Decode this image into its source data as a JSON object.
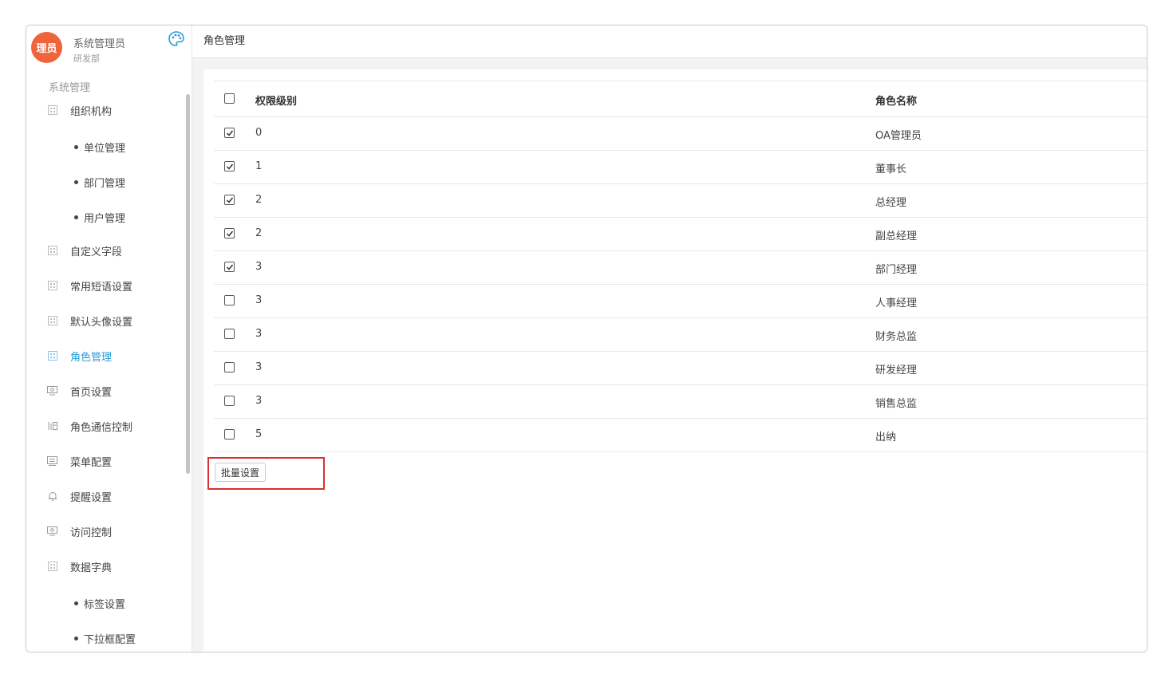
{
  "user": {
    "avatar_text": "理员",
    "name": "系统管理员",
    "department": "研发部"
  },
  "sidebar": {
    "section_title": "系统管理",
    "items": [
      {
        "label": "组织机构",
        "icon": "grid-icon"
      },
      {
        "label": "单位管理",
        "sub": true
      },
      {
        "label": "部门管理",
        "sub": true
      },
      {
        "label": "用户管理",
        "sub": true
      },
      {
        "label": "自定义字段",
        "icon": "grid-icon"
      },
      {
        "label": "常用短语设置",
        "icon": "grid-icon"
      },
      {
        "label": "默认头像设置",
        "icon": "grid-icon"
      },
      {
        "label": "角色管理",
        "icon": "grid-icon",
        "active": true
      },
      {
        "label": "首页设置",
        "icon": "monitor-icon"
      },
      {
        "label": "角色通信控制",
        "icon": "contacts-icon"
      },
      {
        "label": "菜单配置",
        "icon": "menu-icon"
      },
      {
        "label": "提醒设置",
        "icon": "bell-icon"
      },
      {
        "label": "访问控制",
        "icon": "monitor-icon"
      },
      {
        "label": "数据字典",
        "icon": "grid-icon"
      },
      {
        "label": "标签设置",
        "sub": true
      },
      {
        "label": "下拉框配置",
        "sub": true
      }
    ]
  },
  "page": {
    "title": "角色管理"
  },
  "table": {
    "headers": {
      "level": "权限级别",
      "name": "角色名称"
    },
    "rows": [
      {
        "level": "0",
        "name": "OA管理员",
        "checked": true
      },
      {
        "level": "1",
        "name": "董事长",
        "checked": true
      },
      {
        "level": "2",
        "name": "总经理",
        "checked": true
      },
      {
        "level": "2",
        "name": "副总经理",
        "checked": true
      },
      {
        "level": "3",
        "name": "部门经理",
        "checked": true
      },
      {
        "level": "3",
        "name": "人事经理",
        "checked": false
      },
      {
        "level": "3",
        "name": "财务总监",
        "checked": false
      },
      {
        "level": "3",
        "name": "研发经理",
        "checked": false
      },
      {
        "level": "3",
        "name": "销售总监",
        "checked": false
      },
      {
        "level": "5",
        "name": "出纳",
        "checked": false
      }
    ]
  },
  "actions": {
    "batch_label": "批量设置"
  },
  "colors": {
    "accent": "#2a9bd8",
    "avatar": "#f0643c",
    "highlight": "#d9302f"
  }
}
